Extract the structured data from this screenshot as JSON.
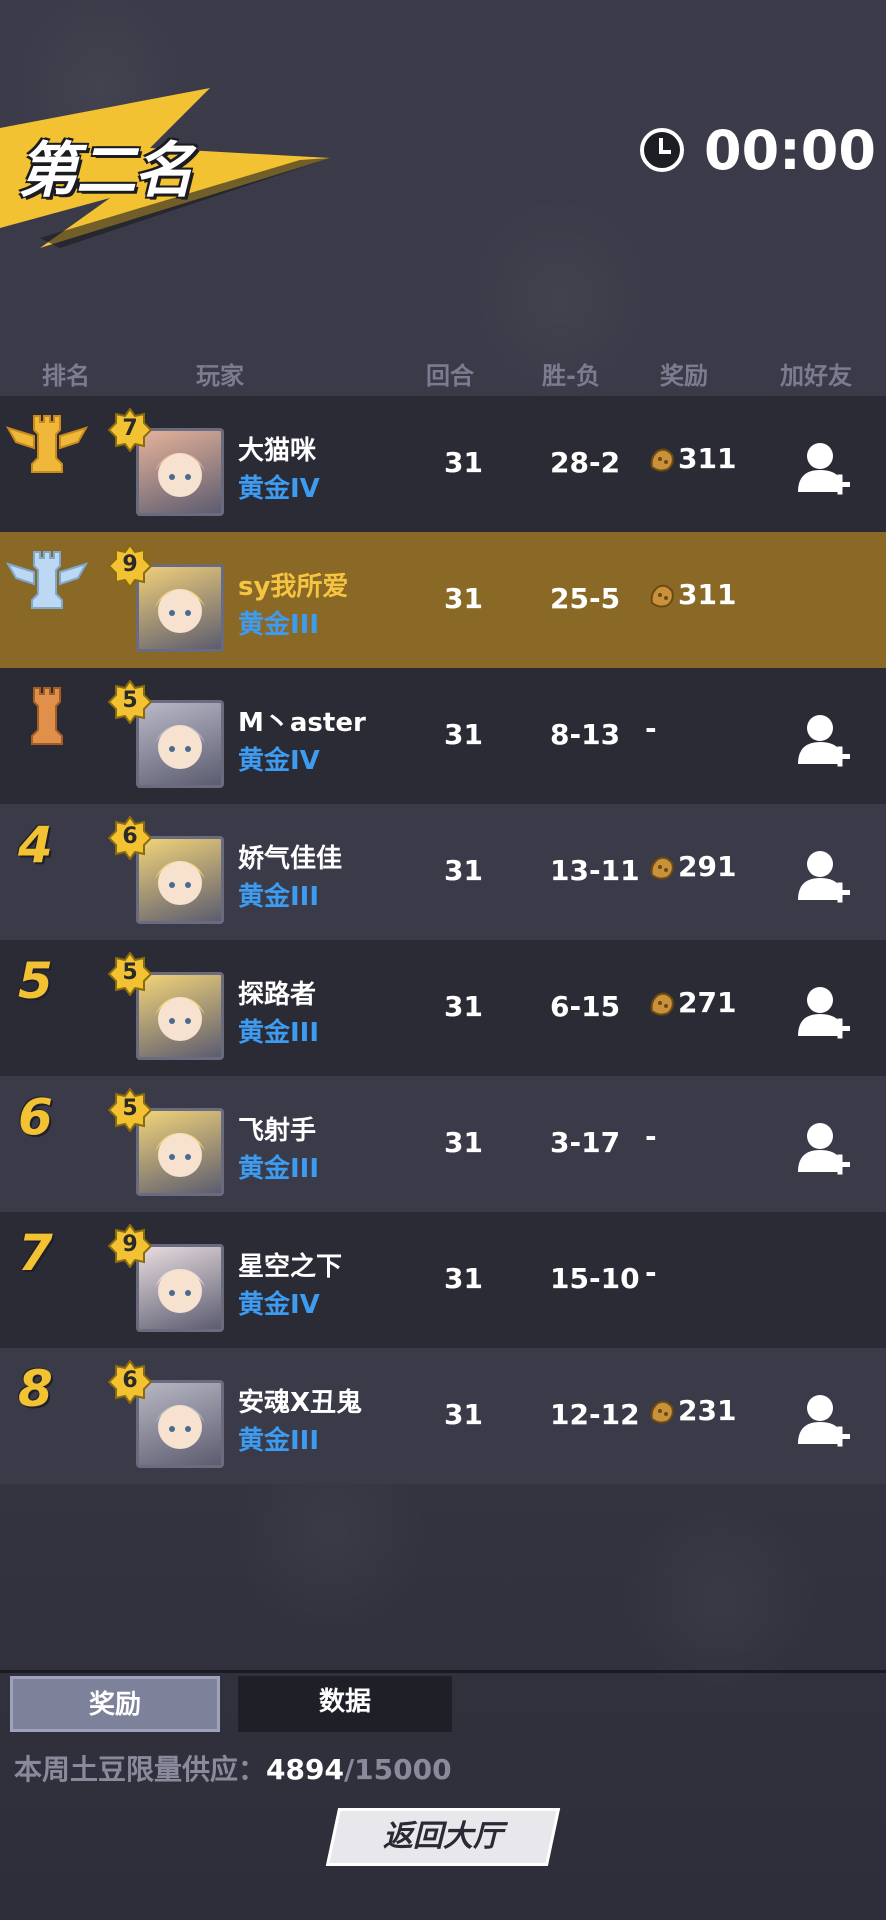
{
  "header": {
    "title": "第二名",
    "timer": "00:00"
  },
  "columns": {
    "rank": "排名",
    "player": "玩家",
    "rounds": "回合",
    "win_loss": "胜-负",
    "reward": "奖励",
    "add_friend": "加好友"
  },
  "rows": [
    {
      "rank": "1",
      "rank_icon": "gold-rook-icon",
      "level": "7",
      "name": "大猫咪",
      "tier": "黄金IV",
      "rounds": "31",
      "win_loss": "28-2",
      "reward": "311",
      "add_friend": true,
      "highlight": false
    },
    {
      "rank": "2",
      "rank_icon": "silver-rook-icon",
      "level": "9",
      "name": "sy我所爱",
      "tier": "黄金III",
      "rounds": "31",
      "win_loss": "25-5",
      "reward": "311",
      "add_friend": false,
      "highlight": true
    },
    {
      "rank": "3",
      "rank_icon": "bronze-rook-icon",
      "level": "5",
      "name": "M丶aster",
      "tier": "黄金IV",
      "rounds": "31",
      "win_loss": "8-13",
      "reward": "-",
      "add_friend": true,
      "highlight": false
    },
    {
      "rank": "4",
      "level": "6",
      "name": "娇气佳佳",
      "tier": "黄金III",
      "rounds": "31",
      "win_loss": "13-11",
      "reward": "291",
      "add_friend": true,
      "highlight": false
    },
    {
      "rank": "5",
      "level": "5",
      "name": "探路者",
      "tier": "黄金III",
      "rounds": "31",
      "win_loss": "6-15",
      "reward": "271",
      "add_friend": true,
      "highlight": false
    },
    {
      "rank": "6",
      "level": "5",
      "name": "飞射手",
      "tier": "黄金III",
      "rounds": "31",
      "win_loss": "3-17",
      "reward": "-",
      "add_friend": true,
      "highlight": false
    },
    {
      "rank": "7",
      "level": "9",
      "name": "星空之下",
      "tier": "黄金IV",
      "rounds": "31",
      "win_loss": "15-10",
      "reward": "-",
      "add_friend": false,
      "highlight": false
    },
    {
      "rank": "8",
      "level": "6",
      "name": "安魂X丑鬼",
      "tier": "黄金III",
      "rounds": "31",
      "win_loss": "12-12",
      "reward": "231",
      "add_friend": true,
      "highlight": false
    }
  ],
  "tabs": {
    "rewards": "奖励",
    "data": "数据"
  },
  "supply": {
    "label": "本周土豆限量供应：",
    "current": "4894",
    "max": "/15000"
  },
  "back_button": "返回大厅",
  "colors": {
    "highlight_row": "#8a6826",
    "tier_blue": "#3d9bf0",
    "rank_gold": "#f2c232"
  }
}
